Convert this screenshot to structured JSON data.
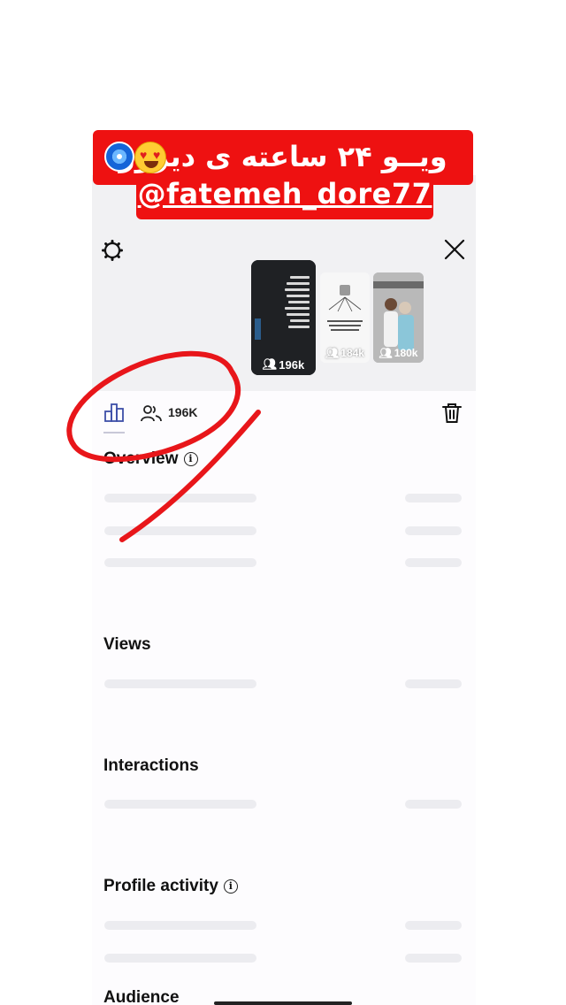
{
  "banner": {
    "caption": "ویــو ۲۴ ساعته ی دیروز",
    "handle": "@fatemeh_dore77",
    "emojis": [
      "evil-eye-icon",
      "heart-eyes-icon"
    ]
  },
  "header": {
    "settings_icon": "gear-icon",
    "close_icon": "close-icon"
  },
  "stories": [
    {
      "count": "196k",
      "selected": true
    },
    {
      "count": "184k",
      "selected": false
    },
    {
      "count": "180k",
      "selected": false
    }
  ],
  "toolbar": {
    "insights_icon": "bar-chart-icon",
    "viewers_icon": "people-icon",
    "viewers_count": "196K",
    "delete_icon": "trash-icon"
  },
  "sections": {
    "overview": "Overview",
    "views": "Views",
    "interactions": "Interactions",
    "profile_activity": "Profile activity",
    "audience": "Audience",
    "info_glyph": "i"
  },
  "colors": {
    "banner_red": "#ee1111",
    "annotation_red": "#e8161a",
    "accent_blue": "#3d4fa8"
  }
}
